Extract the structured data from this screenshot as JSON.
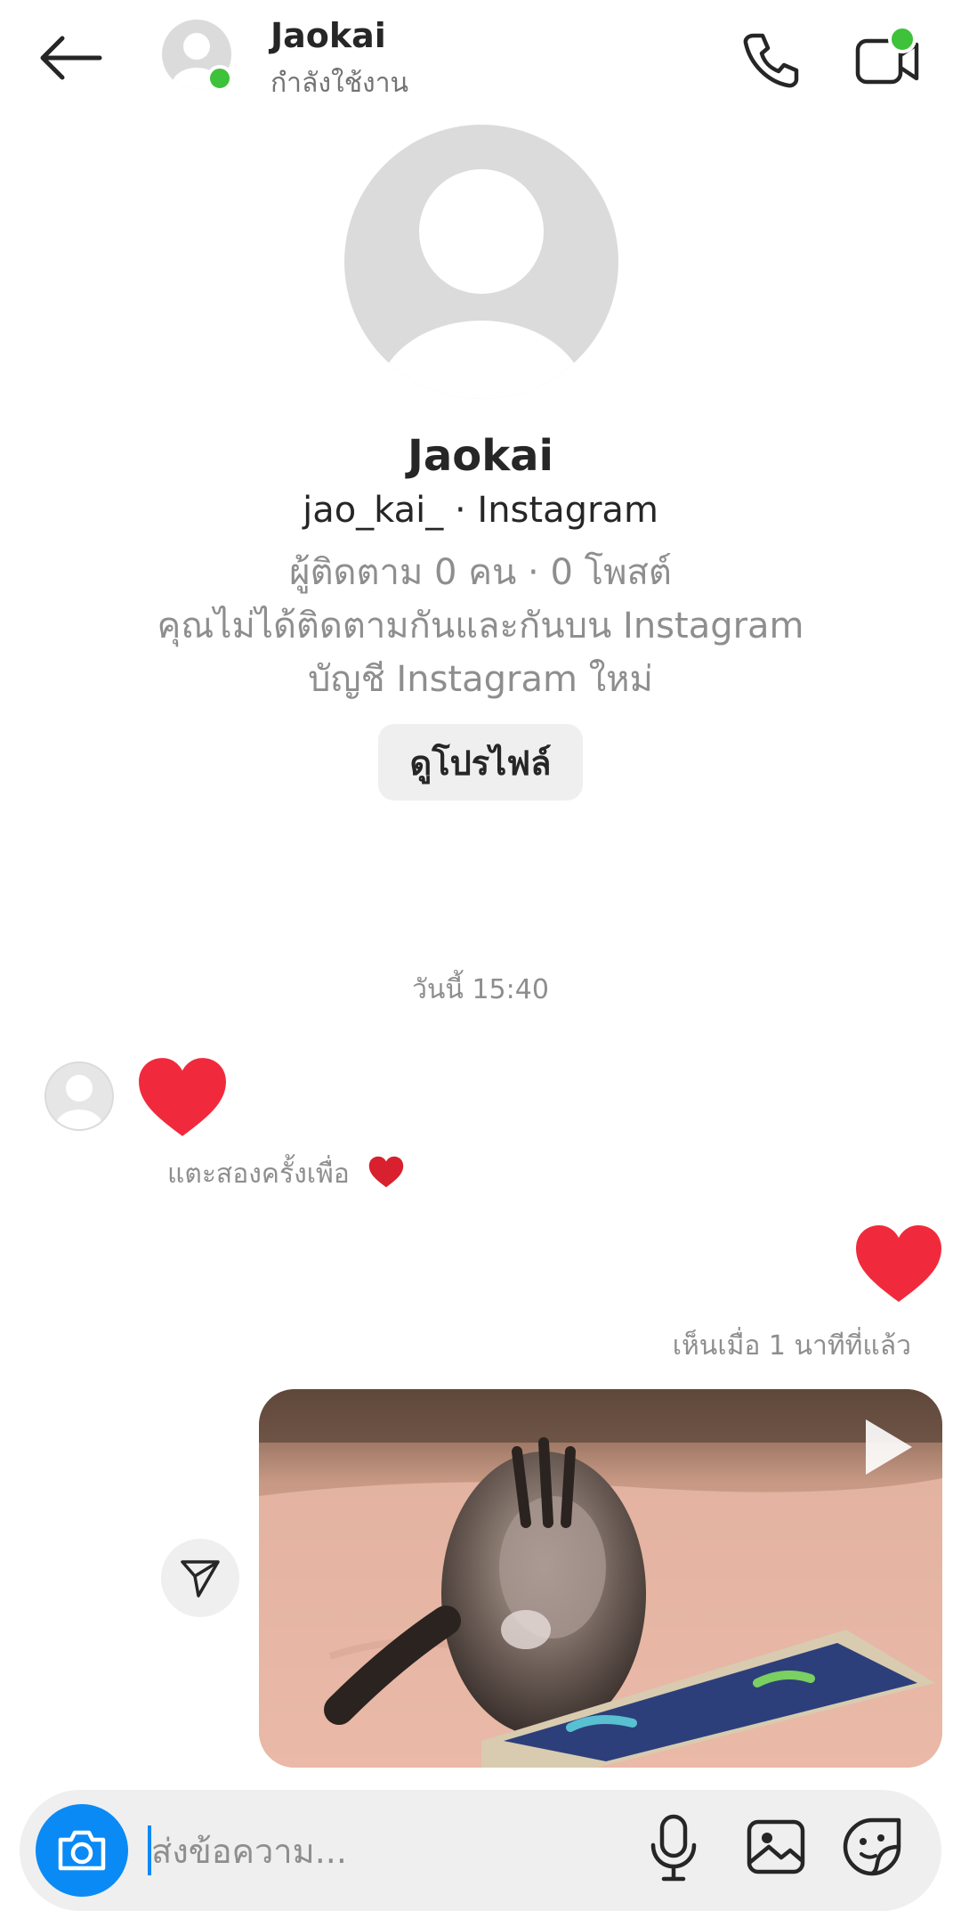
{
  "header": {
    "name": "Jaokai",
    "status": "กำลังใช้งาน"
  },
  "profile": {
    "name": "Jaokai",
    "handle": "jao_kai_ · Instagram",
    "stats": "ผู้ติดตาม 0 คน · 0 โพสต์",
    "relation": "คุณไม่ได้ติดตามกันและกันบน Instagram",
    "account_note": "บัญชี Instagram ใหม่",
    "view_profile_label": "ดูโปรไฟล์"
  },
  "thread": {
    "timestamp": "วันนี้ 15:40",
    "received_hint": "แตะสองครั้งเพื่อ",
    "seen_status": "เห็นเมื่อ 1 นาทีที่แล้ว"
  },
  "composer": {
    "placeholder": "ส่งข้อความ..."
  },
  "colors": {
    "accent": "#0a8af5",
    "online": "#3dc23a",
    "heart": "#f02a3c"
  },
  "icons": [
    "back-arrow-icon",
    "phone-icon",
    "video-call-icon",
    "heart-icon",
    "send-icon",
    "play-icon",
    "camera-icon",
    "microphone-icon",
    "gallery-icon",
    "sticker-icon"
  ]
}
